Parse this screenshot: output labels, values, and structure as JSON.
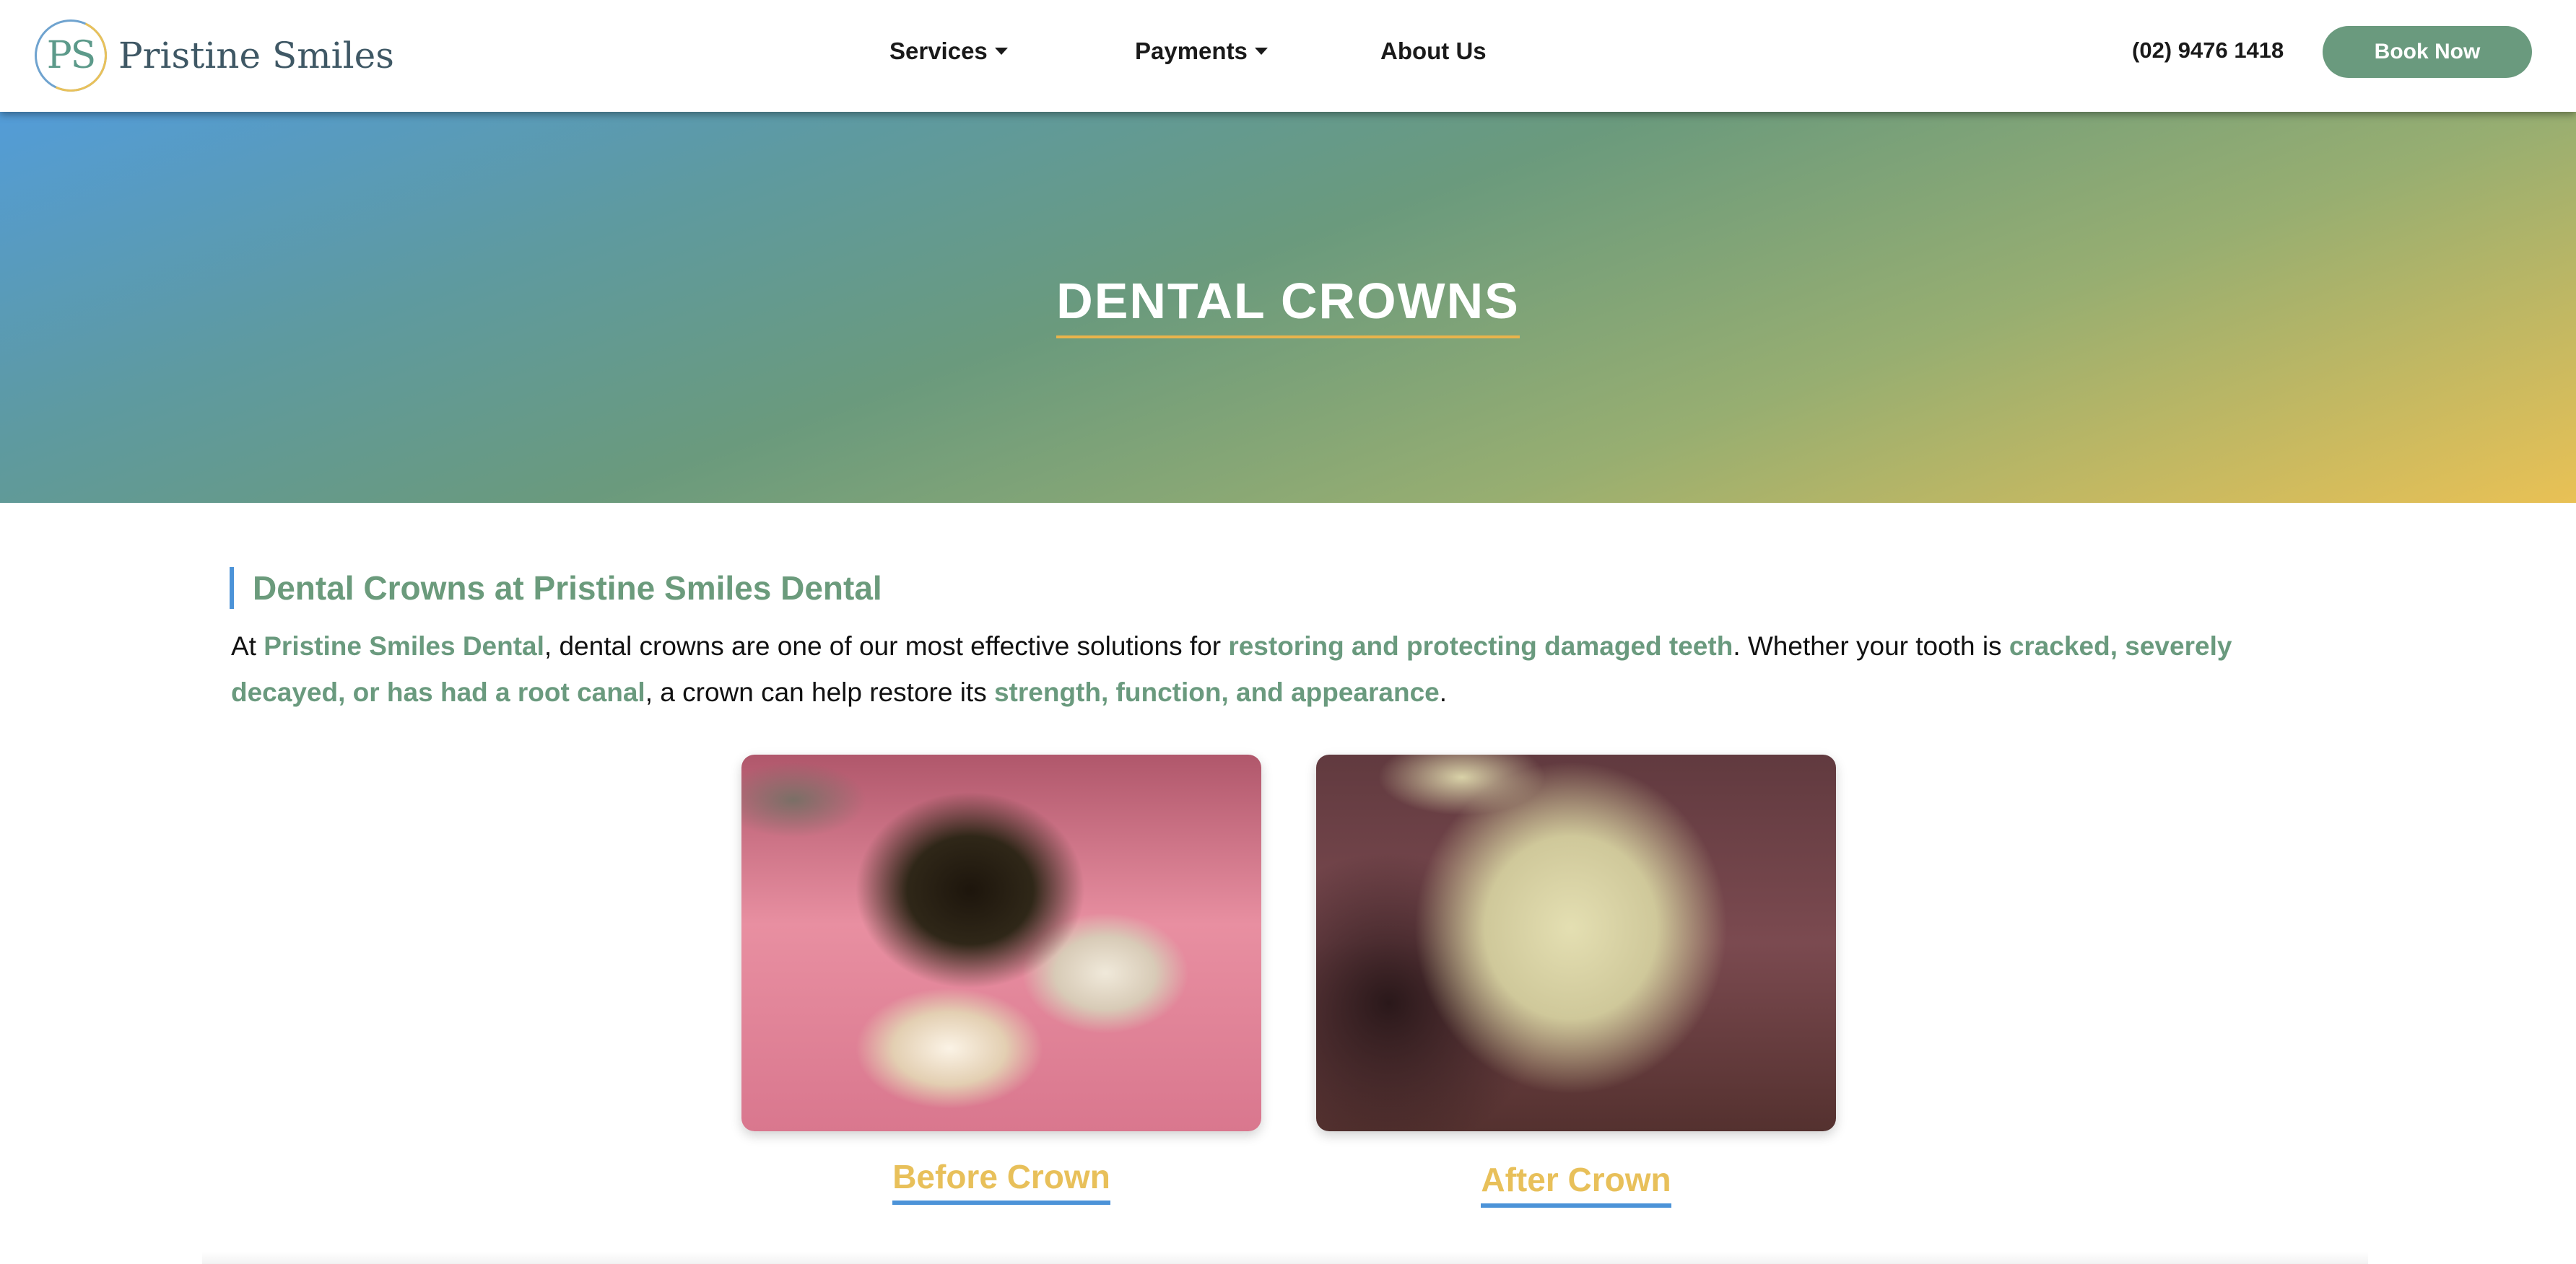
{
  "brand": {
    "initials": "PS",
    "name": "Pristine Smiles"
  },
  "nav": {
    "items": [
      {
        "label": "Services",
        "has_dropdown": true
      },
      {
        "label": "Payments",
        "has_dropdown": true
      },
      {
        "label": "About Us",
        "has_dropdown": false
      }
    ],
    "phone": "(02) 9476 1418",
    "cta": "Book Now"
  },
  "hero": {
    "title": "DENTAL CROWNS"
  },
  "content": {
    "heading": "Dental Crowns at Pristine Smiles Dental",
    "intro": {
      "p1": "At ",
      "h1": "Pristine Smiles Dental",
      "p2": ", dental crowns are one of our most effective solutions for ",
      "h2": "restoring and protecting damaged teeth",
      "p3": ". Whether your tooth is ",
      "h3": "cracked, severely decayed, or has had a root canal",
      "p4": ", a crown can help restore its ",
      "h4": "strength, function, and appearance",
      "p5": "."
    },
    "gallery": [
      {
        "caption": "Before Crown",
        "image": "decayed-tooth-photo"
      },
      {
        "caption": "After Crown",
        "image": "crowned-tooth-photo"
      }
    ]
  },
  "colors": {
    "brand_green": "#6a9a7e",
    "accent_gold": "#e8c05a",
    "accent_blue": "#4c93d8",
    "hero_gradient": [
      "#539cd8",
      "#6a9a7d",
      "#e9c155"
    ]
  }
}
